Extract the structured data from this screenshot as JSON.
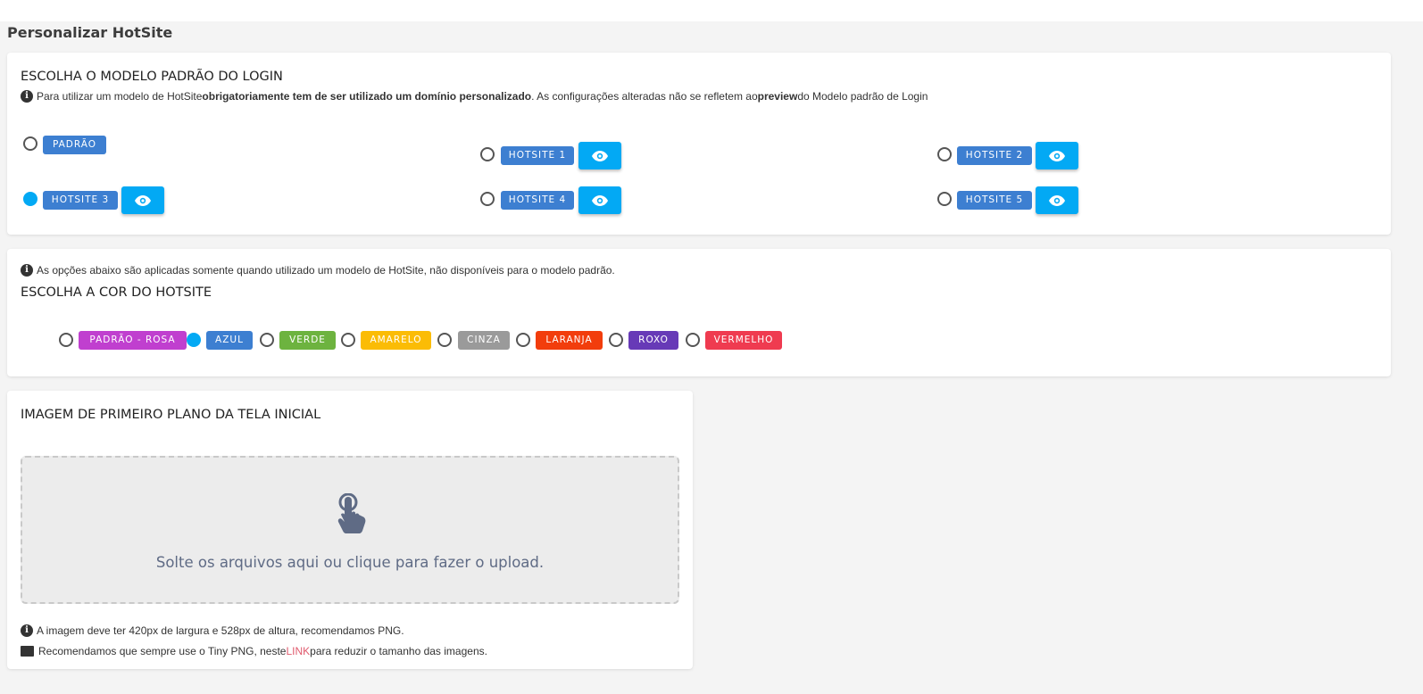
{
  "page": {
    "title": "Personalizar HotSite"
  },
  "login_model": {
    "title": "ESCOLHA O MODELO PADRÃO DO LOGIN",
    "info": {
      "part1": "Para utilizar um modelo de HotSite ",
      "bold1": "obrigatoriamente tem de ser utilizado um domínio personalizado",
      "part2": ". As configurações alteradas não se refletem ao ",
      "bold2": "preview",
      "part3": " do Modelo padrão de Login"
    },
    "options": [
      {
        "label": "PADRÃO",
        "checked": false,
        "preview": false
      },
      {
        "label": "HOTSITE 1",
        "checked": false,
        "preview": true
      },
      {
        "label": "HOTSITE 2",
        "checked": false,
        "preview": true
      },
      {
        "label": "HOTSITE 3",
        "checked": true,
        "preview": true
      },
      {
        "label": "HOTSITE 4",
        "checked": false,
        "preview": true
      },
      {
        "label": "HOTSITE 5",
        "checked": false,
        "preview": true
      }
    ],
    "tag_color": "#3d7fd1",
    "preview_color": "#03a9f4"
  },
  "color_section": {
    "info": "As opções abaixo são aplicadas somente quando utilizado um modelo de HotSite, não disponíveis para o modelo padrão.",
    "title": "ESCOLHA A COR DO HOTSITE",
    "options": [
      {
        "label": "PADRÃO - ROSA",
        "color": "#c03fcf",
        "checked": false
      },
      {
        "label": "AZUL",
        "color": "#3d7fd1",
        "checked": true
      },
      {
        "label": "VERDE",
        "color": "#6db33f",
        "checked": false
      },
      {
        "label": "AMARELO",
        "color": "#fbbc05",
        "checked": false
      },
      {
        "label": "CINZA",
        "color": "#9a9a9a",
        "checked": false
      },
      {
        "label": "LARANJA",
        "color": "#f23d0c",
        "checked": false
      },
      {
        "label": "ROXO",
        "color": "#673ab7",
        "checked": false
      },
      {
        "label": "VERMELHO",
        "color": "#ef3b50",
        "checked": false
      }
    ]
  },
  "image_section": {
    "title": "IMAGEM DE PRIMEIRO PLANO DA TELA INICIAL",
    "dropzone_text": "Solte os arquivos aqui ou clique para fazer o upload.",
    "dropzone_icon": "hand-pointer-icon",
    "info1": "A imagem deve ter 420px de largura e 528px de altura, recomendamos PNG.",
    "info2_before": "Recomendamos que sempre use o Tiny PNG, neste ",
    "info2_link": "LINK",
    "info2_after": " para reduzir o tamanho das imagens."
  }
}
